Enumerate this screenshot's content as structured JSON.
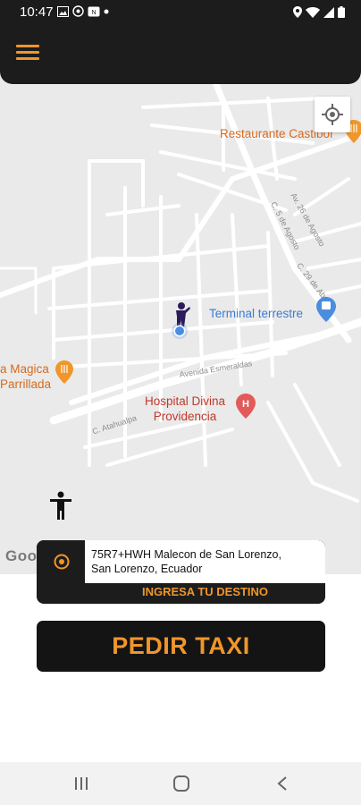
{
  "status_bar": {
    "time": "10:47",
    "left_icons": [
      "gallery-icon",
      "whatsapp-icon",
      "nfc-icon",
      "dot-icon"
    ],
    "right_icons": [
      "location-icon",
      "wifi-icon",
      "signal-icon",
      "battery-icon"
    ]
  },
  "header": {
    "menu_icon": "hamburger-menu-icon",
    "accent_color": "#f0962a",
    "background_color": "#1c1c1c"
  },
  "map": {
    "labels": {
      "restaurant": "Restaurante Castibor",
      "terminal": "Terminal terrestre",
      "magica_line1": "a Magica",
      "magica_line2": "Parrillada",
      "hospital_line1": "Hospital Divina",
      "hospital_line2": "Providencia",
      "street_26_agosto": "Av. 26 de Agosto",
      "street_5_agosto": "C. 5 de Agosto",
      "street_29_abril": "C. 29 de Abril",
      "street_esmeraldas": "Avenida Esmeraldas",
      "street_atahualpa": "C. Atahualpa"
    },
    "attribution": "Google",
    "locate_icon": "my-location-icon"
  },
  "address_card": {
    "address_line1": "75R7+HWH Malecon de San Lorenzo,",
    "address_line2": "San Lorenzo, Ecuador",
    "destination_prompt": "INGRESA TU DESTINO",
    "pin_icon": "origin-pin-icon"
  },
  "primary_action": {
    "label": "PEDIR TAXI"
  },
  "nav_bar": {
    "items": [
      "recents-icon",
      "home-icon",
      "back-icon"
    ]
  }
}
